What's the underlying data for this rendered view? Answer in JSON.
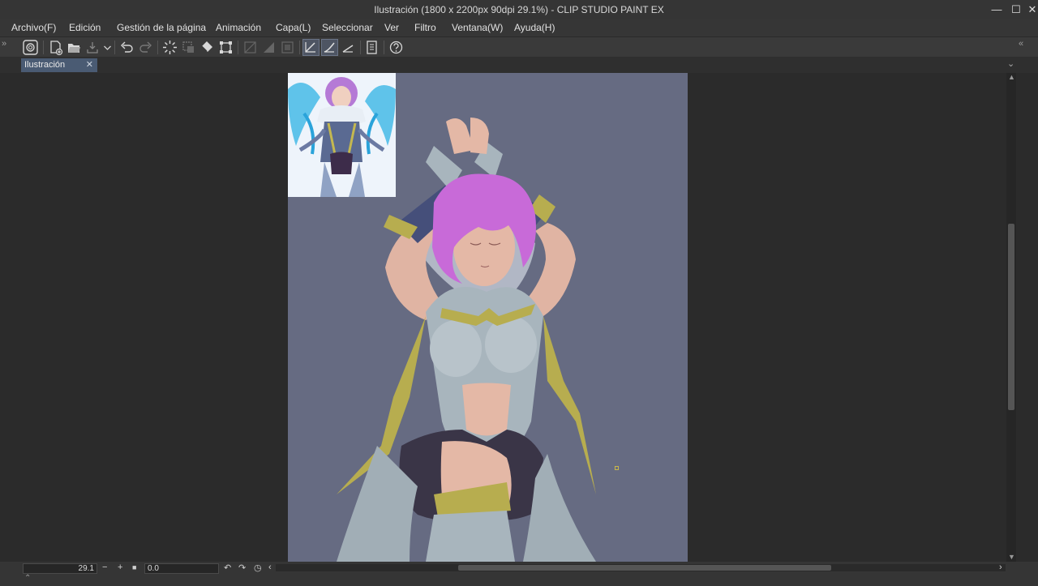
{
  "window": {
    "title": "Ilustración (1800 x 2200px 90dpi 29.1%)  - CLIP STUDIO PAINT EX",
    "minimize": "—",
    "maximize": "☐",
    "close": "✕"
  },
  "menubar": {
    "items": [
      "Archivo(F)",
      "Edición",
      "Gestión de la página",
      "Animación",
      "Capa(L)",
      "Seleccionar",
      "Ver",
      "Filtro",
      "Ventana(W)",
      "Ayuda(H)"
    ]
  },
  "toolbar": {
    "buttons": [
      "clip-studio-logo-icon",
      "new-file-icon",
      "open-file-icon",
      "save-icon",
      "undo-icon",
      "redo-icon",
      "loading-icon",
      "clear-icon",
      "fill-icon",
      "transform-icon",
      "snap-ruler-icon",
      "snap-special-ruler-icon",
      "snap-grid-icon",
      "active-pen-icon",
      "active-curve-icon",
      "active-ruler-icon",
      "page-icon",
      "help-icon"
    ]
  },
  "tab": {
    "label": "Ilustración",
    "close": "✕"
  },
  "status": {
    "zoom": "29.1",
    "angle": "0.0",
    "zoom_minus": "−",
    "zoom_plus": "+",
    "stop": "■"
  },
  "colors": {
    "canvas_bg": "#666b82",
    "accent_active": "#4a5b73",
    "hair": "#c86ad8",
    "gold": "#b7ad4f",
    "outfit": "#a8b5bd",
    "skin": "#e4b8a6"
  }
}
